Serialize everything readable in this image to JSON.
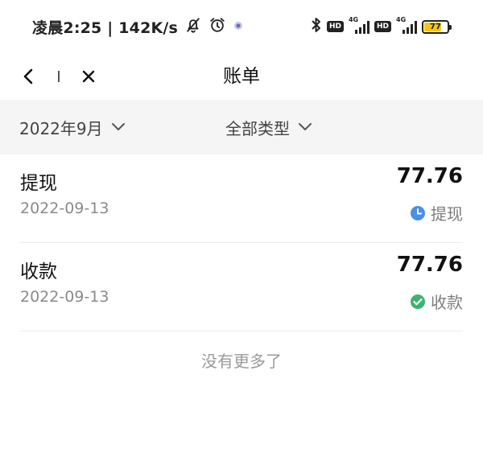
{
  "status_bar": {
    "time_speed": "凌晨2:25 | 142K/s",
    "hd_label": "HD",
    "network_label": "4G",
    "battery_level": "77",
    "battery_fraction": 0.77,
    "battery_color": "#f5c518"
  },
  "nav": {
    "title": "账单"
  },
  "filters": {
    "month_label": "2022年9月",
    "type_label": "全部类型"
  },
  "records": [
    {
      "title": "提现",
      "date": "2022-09-13",
      "amount": "77.76",
      "status": "提现",
      "status_icon": "clock-icon",
      "status_color": "#4a90e2"
    },
    {
      "title": "收款",
      "date": "2022-09-13",
      "amount": "77.76",
      "status": "收款",
      "status_icon": "check-circle-icon",
      "status_color": "#3cb371"
    }
  ],
  "footer": {
    "no_more_text": "没有更多了"
  }
}
